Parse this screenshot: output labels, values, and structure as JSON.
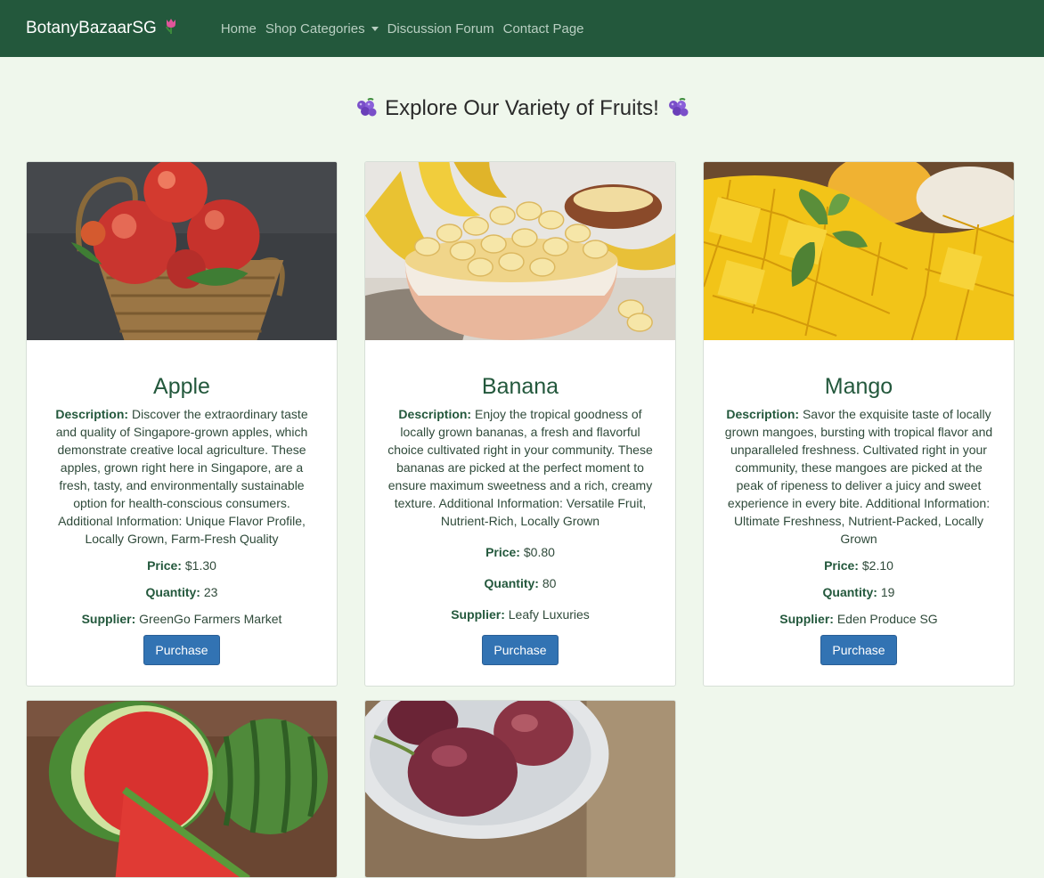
{
  "nav": {
    "brand": "BotanyBazaarSG",
    "brand_icon": "tulip-icon",
    "links": [
      "Home",
      "Shop Categories",
      "Discussion Forum",
      "Contact Page"
    ]
  },
  "heading": "Explore Our Variety of Fruits!",
  "heading_icon": "grapes-icon",
  "labels": {
    "description": "Description:",
    "price": "Price:",
    "quantity": "Quantity:",
    "supplier": "Supplier:"
  },
  "products": [
    {
      "name": "Apple",
      "description": "Discover the extraordinary taste and quality of Singapore-grown apples, which demonstrate creative local agriculture. These apples, grown right here in Singapore, are a fresh, tasty, and environmentally sustainable option for health-conscious consumers. Additional Information: Unique Flavor Profile, Locally Grown, Farm-Fresh Quality",
      "price": "$1.30",
      "quantity": "23",
      "supplier": "GreenGo Farmers Market",
      "button": "Purchase"
    },
    {
      "name": "Banana",
      "description": "Enjoy the tropical goodness of locally grown bananas, a fresh and flavorful choice cultivated right in your community. These bananas are picked at the perfect moment to ensure maximum sweetness and a rich, creamy texture. Additional Information: Versatile Fruit, Nutrient-Rich, Locally Grown",
      "price": "$0.80",
      "quantity": "80",
      "supplier": "Leafy Luxuries",
      "button": "Purchase"
    },
    {
      "name": "Mango",
      "description": "Savor the exquisite taste of locally grown mangoes, bursting with tropical flavor and unparalleled freshness. Cultivated right in your community, these mangoes are picked at the peak of ripeness to deliver a juicy and sweet experience in every bite. Additional Information: Ultimate Freshness, Nutrient-Packed, Locally Grown",
      "price": "$2.10",
      "quantity": "19",
      "supplier": "Eden Produce SG",
      "button": "Purchase"
    }
  ]
}
